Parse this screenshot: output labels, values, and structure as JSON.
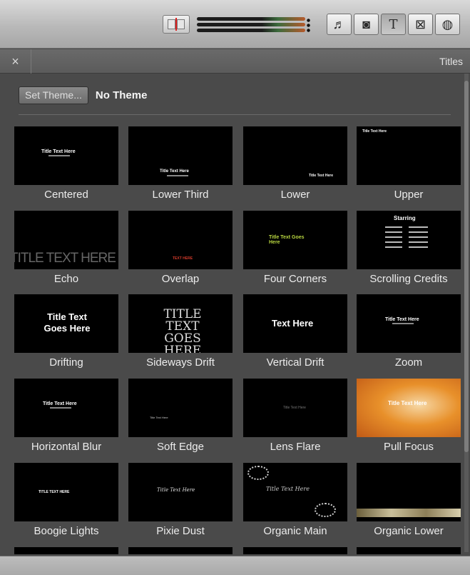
{
  "toolbar": {
    "buttons": [
      {
        "name": "music-icon",
        "glyph": "♬"
      },
      {
        "name": "camera-icon",
        "glyph": "◙"
      },
      {
        "name": "titles-icon",
        "glyph": "T"
      },
      {
        "name": "transitions-icon",
        "glyph": "⊠"
      },
      {
        "name": "maps-icon",
        "glyph": "◍"
      }
    ],
    "active": "titles-icon"
  },
  "panel": {
    "close_glyph": "×",
    "title": "Titles"
  },
  "theme": {
    "button_label": "Set Theme...",
    "current": "No Theme"
  },
  "titles": [
    {
      "label": "Centered",
      "preview": "Title Text Here"
    },
    {
      "label": "Lower Third",
      "preview": "Title Text Here"
    },
    {
      "label": "Lower",
      "preview": "Title Text Here"
    },
    {
      "label": "Upper",
      "preview": "Title Text Here"
    },
    {
      "label": "Echo",
      "preview": "TITLE TEXT HERE"
    },
    {
      "label": "Overlap",
      "preview": "TEXT HERE"
    },
    {
      "label": "Four Corners",
      "preview": "Title Text Goes Here"
    },
    {
      "label": "Scrolling Credits",
      "preview": "Starring"
    },
    {
      "label": "Drifting",
      "preview": "Title Text Goes Here"
    },
    {
      "label": "Sideways Drift",
      "preview": "TITLE TEXT GOES HERE"
    },
    {
      "label": "Vertical Drift",
      "preview": "Text Here"
    },
    {
      "label": "Zoom",
      "preview": "Title Text Here"
    },
    {
      "label": "Horizontal Blur",
      "preview": "Title Text Here"
    },
    {
      "label": "Soft Edge",
      "preview": "Title Text Here"
    },
    {
      "label": "Lens Flare",
      "preview": "Title Text Here"
    },
    {
      "label": "Pull Focus",
      "preview": "Title Text Here"
    },
    {
      "label": "Boogie Lights",
      "preview": "TITLE TEXT HERE"
    },
    {
      "label": "Pixie Dust",
      "preview": "Title Text Here"
    },
    {
      "label": "Organic Main",
      "preview": "Title Text Here"
    },
    {
      "label": "Organic Lower",
      "preview": ""
    }
  ],
  "colors": {
    "panel_bg": "#4a4a4a",
    "tile_bg": "#000000",
    "pull_focus_bg": "#e8902a",
    "four_corners_text": "#b8d640",
    "overlap_red": "#d23a2a"
  }
}
